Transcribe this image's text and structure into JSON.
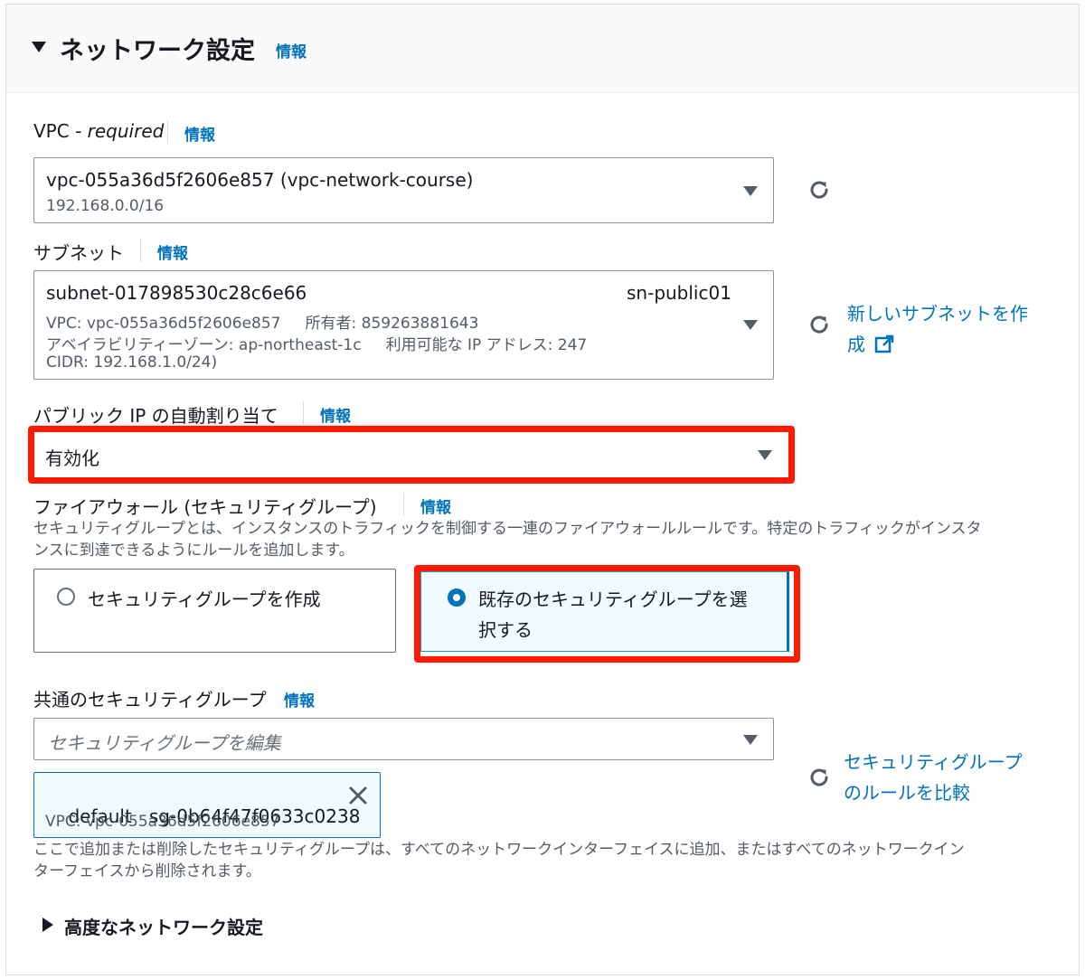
{
  "header": {
    "title": "ネットワーク設定",
    "info": "情報"
  },
  "vpc": {
    "label": "VPC - ",
    "label_required": "required",
    "info": "情報",
    "value": "vpc-055a36d5f2606e857 (vpc-network-course)",
    "cidr": "192.168.0.0/16"
  },
  "subnet": {
    "label": "サブネット",
    "info": "情報",
    "id": "subnet-017898530c28c6e66",
    "name": "sn-public01",
    "line1": "VPC: vpc-055a36d5f2606e857     所有者: 859263881643",
    "line2": "アベイラビリティーゾーン: ap-northeast-1c     利用可能な IP アドレス: 247",
    "line3": "CIDR: 192.168.1.0/24)",
    "create_link_1": "新しいサブネットを作",
    "create_link_2": "成"
  },
  "public_ip": {
    "label": "パブリック IP の自動割り当て",
    "info": "情報",
    "value": "有効化"
  },
  "firewall": {
    "label": "ファイアウォール (セキュリティグループ)",
    "info": "情報",
    "desc_1": "セキュリティグループとは、インスタンスのトラフィックを制御する一連のファイアウォールルールです。特定のトラフィックがインスタ",
    "desc_2": "ンスに到達できるようにルールを追加します。",
    "option_create": "セキュリティグループを作成",
    "option_existing_1": "既存のセキュリティグループを選",
    "option_existing_2": "択する"
  },
  "common_sg": {
    "label": "共通のセキュリティグループ",
    "info": "情報",
    "placeholder": "セキュリティグループを編集",
    "compare_link_1": "セキュリティグループ",
    "compare_link_2": "のルールを比較",
    "token_name": "default",
    "token_id": "sg-0b64f47f0633c0238",
    "token_vpc": "VPC: vpc-055a36d5f2606e857",
    "note_1": "ここで追加または削除したセキュリティグループは、すべてのネットワークインターフェイスに追加、またはすべてのネットワークイン",
    "note_2": "ターフェイスから削除されます。"
  },
  "advanced": {
    "label": "高度なネットワーク設定"
  },
  "colors": {
    "accent": "#0073bb",
    "highlight_frame": "#ff1a00",
    "text": "#16191f",
    "muted": "#545b64"
  }
}
